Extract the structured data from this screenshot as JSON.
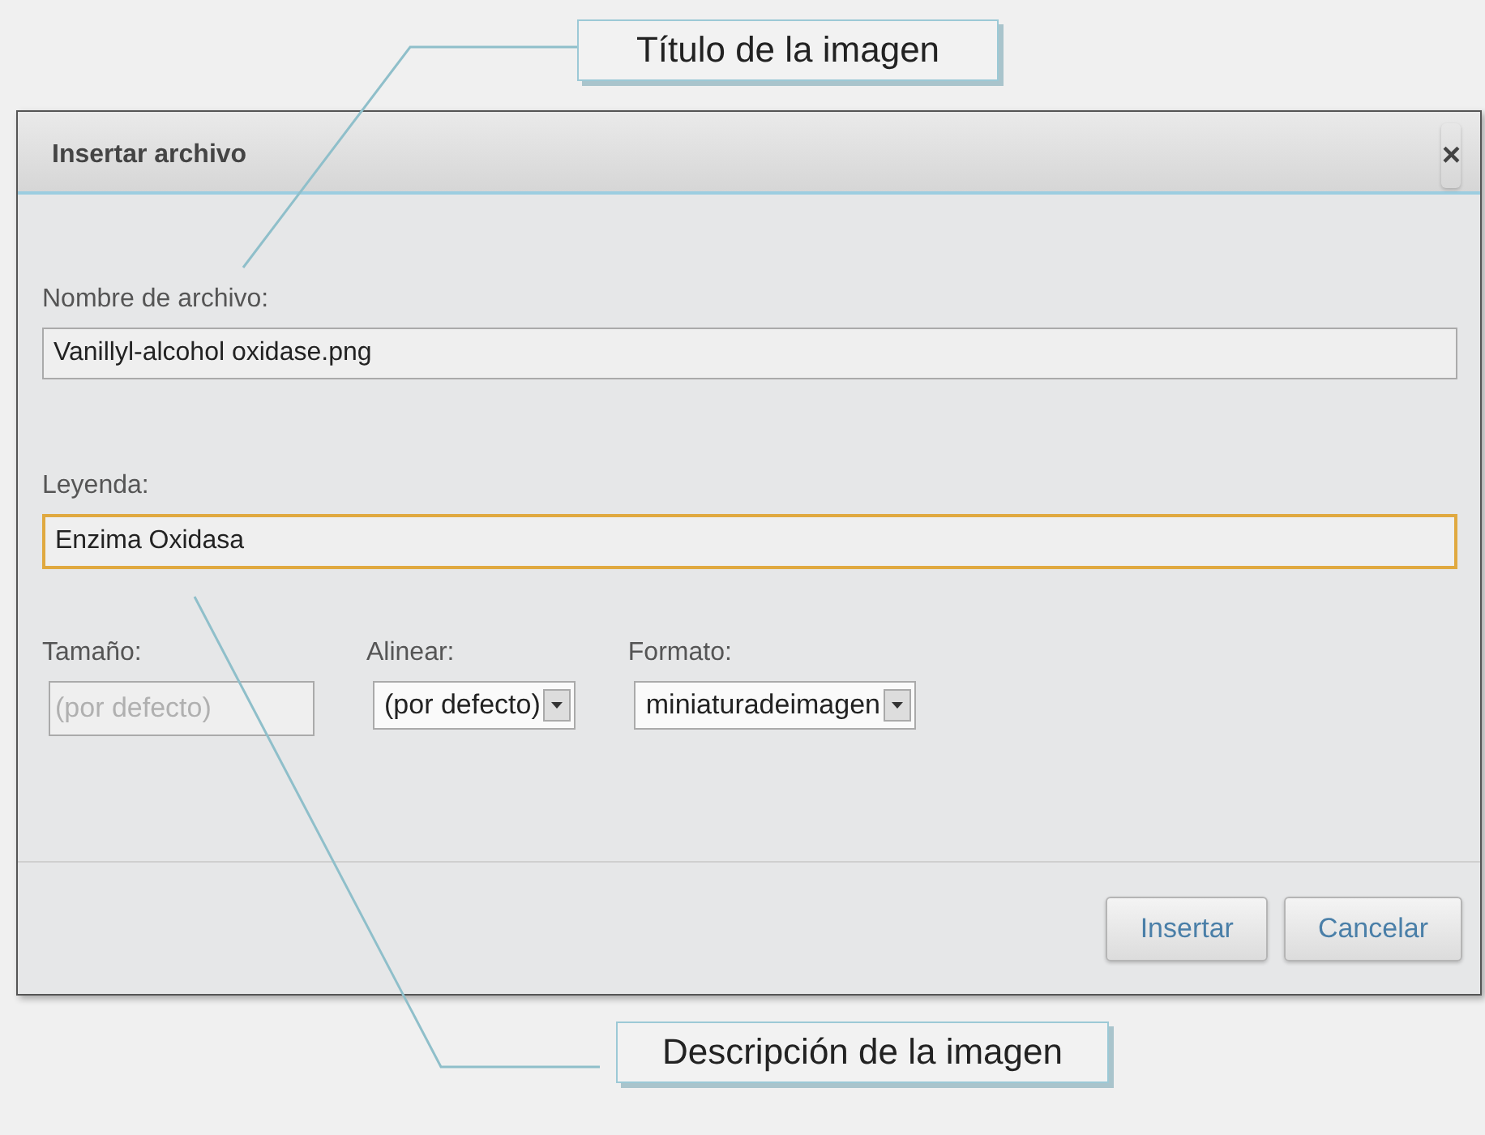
{
  "dialog": {
    "title": "Insertar archivo",
    "close": "×",
    "fields": [
      {
        "label": "Nombre de archivo:",
        "value": "Vanillyl-alcohol oxidase.png",
        "focused": false
      },
      {
        "label": "Leyenda:",
        "value": "Enzima Oxidasa",
        "focused": true
      }
    ],
    "options": [
      {
        "kind": "text",
        "label": "Tamaño:",
        "placeholder": "(por defecto)"
      },
      {
        "kind": "select",
        "label": "Alinear:",
        "value": "(por defecto)"
      },
      {
        "kind": "select",
        "label": "Formato:",
        "value": "miniaturadeimagen"
      }
    ],
    "buttons": [
      "Insertar",
      "Cancelar"
    ]
  },
  "callouts": [
    {
      "text": "Título de la imagen"
    },
    {
      "text": "Descripción de la imagen"
    }
  ]
}
